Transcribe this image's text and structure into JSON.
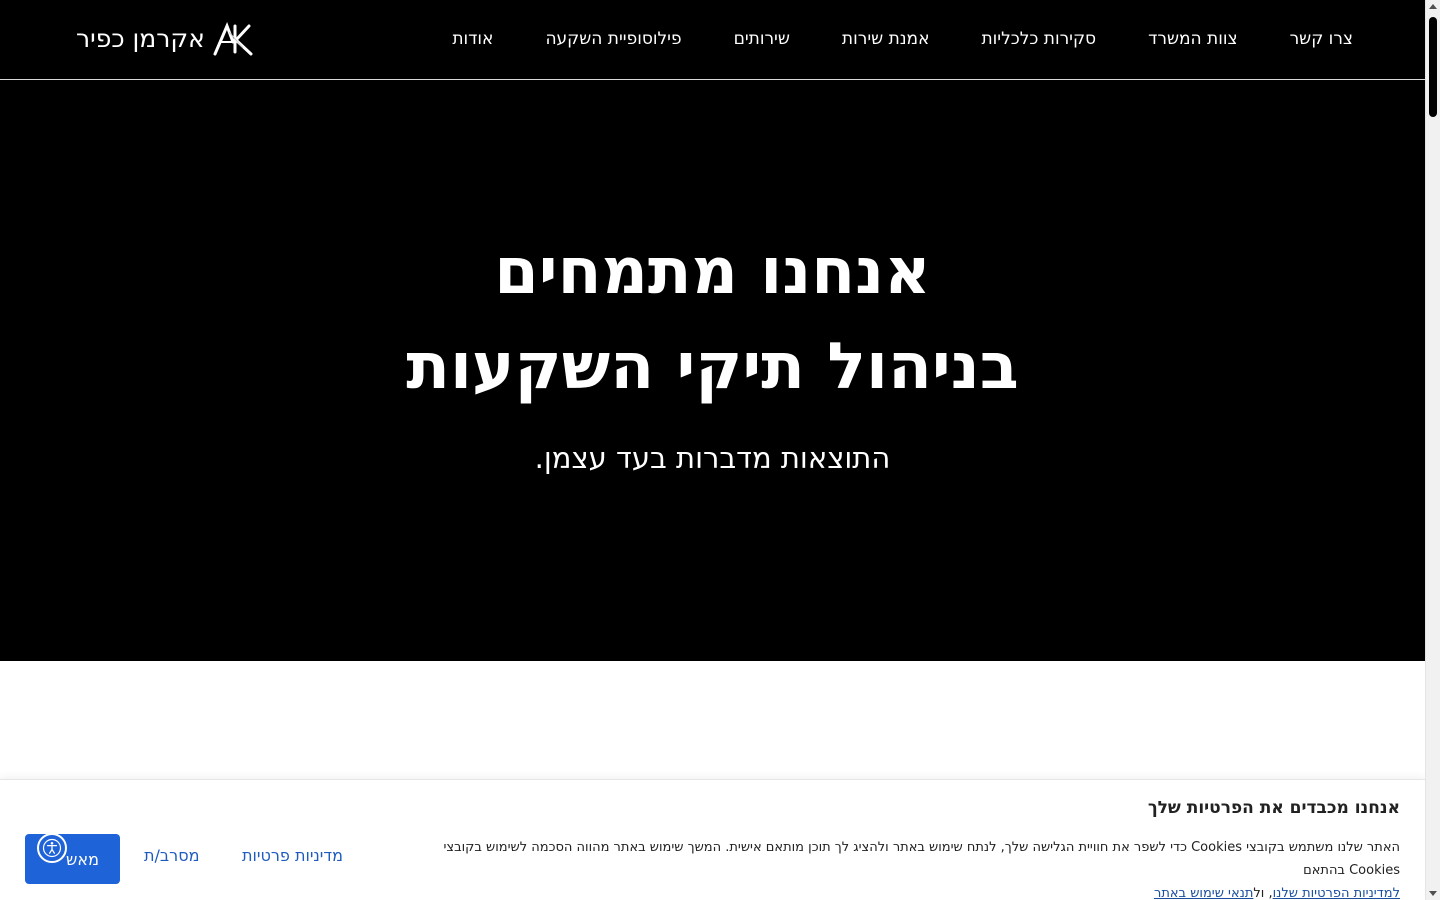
{
  "header": {
    "logo_text": "אקרמן כפיר",
    "logo_icon": "ak-monogram-icon",
    "nav": [
      "אודות",
      "פילוסופיית השקעה",
      "שירותים",
      "אמנת שירות",
      "סקירות כלכליות",
      "צוות המשרד",
      "צרו קשר"
    ]
  },
  "hero": {
    "title_line1": "אנחנו מתמחים",
    "title_line2": "בניהול תיקי השקעות",
    "subtitle": "התוצאות מדברות בעד עצמן."
  },
  "cookie": {
    "title": "אנחנו מכבדים את הפרטיות שלך",
    "body_text": "האתר שלנו משתמש בקובצי Cookies כדי לשפר את חוויית הגלישה שלך, לנתח שימוש באתר ולהציג לך תוכן מותאם אישית. המשך שימוש באתר מהווה הסכמה לשימוש בקובצי Cookies בהתאם",
    "privacy_link": "למדיניות הפרטיות שלנו",
    "joiner": ", ול",
    "terms_link": "תנאי שימוש באתר",
    "accept_label": "מאשר/ת",
    "accept_visible": "מאש",
    "reject_label": "מסרב/ת",
    "policy_label": "מדיניות פרטיות"
  },
  "colors": {
    "hero_bg": "#000000",
    "accent": "#1f63d8",
    "link": "#1f5bbf"
  },
  "accessibility_icon": "accessibility-icon"
}
